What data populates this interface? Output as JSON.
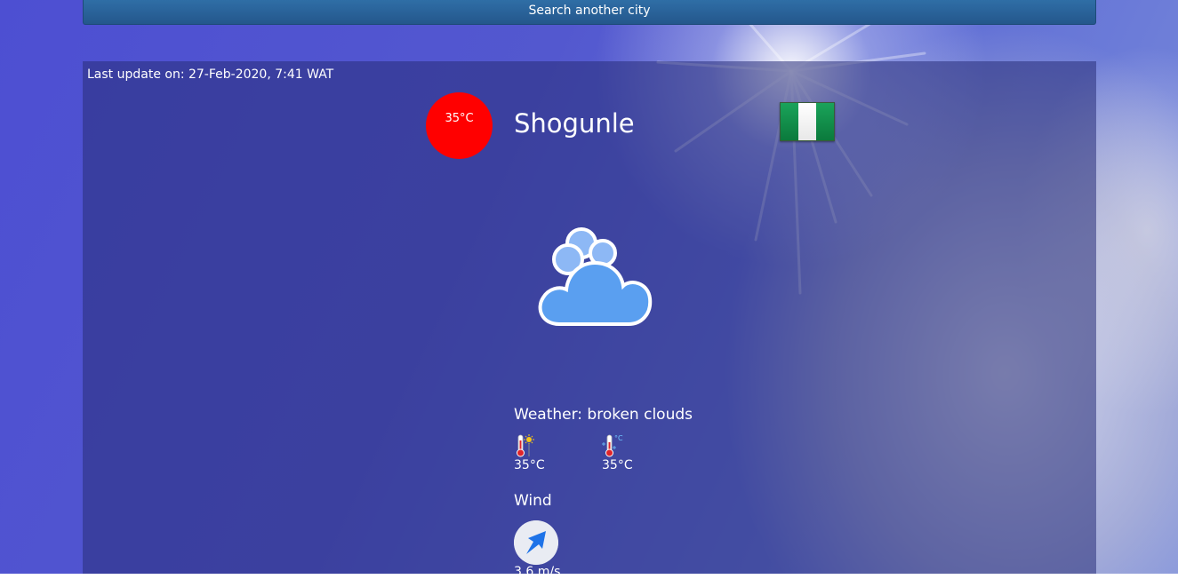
{
  "search": {
    "label": "Search another city"
  },
  "update": {
    "text": "Last update on: 27-Feb-2020, 7:41 WAT"
  },
  "location": {
    "temperature": "35°C",
    "city": "Shogunle",
    "flag_icon": "nigeria-flag",
    "flag_colors": [
      "#008751",
      "#ffffff",
      "#008751"
    ]
  },
  "weather": {
    "icon": "broken-clouds-icon",
    "description": "Weather: broken clouds"
  },
  "temps": {
    "max_icon": "thermometer-hot-icon",
    "max": "35°C",
    "min_icon": "thermometer-cold-icon",
    "min": "35°C"
  },
  "wind": {
    "title": "Wind",
    "direction_icon": "compass-arrow-icon",
    "speed": "3.6 m/s"
  }
}
